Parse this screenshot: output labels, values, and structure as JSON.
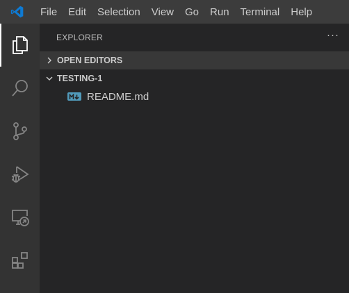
{
  "titlebar": {
    "app_icon": "vscode-logo-icon",
    "menu": [
      "File",
      "Edit",
      "Selection",
      "View",
      "Go",
      "Run",
      "Terminal",
      "Help"
    ]
  },
  "activitybar": {
    "items": [
      {
        "icon": "files-icon",
        "active": true
      },
      {
        "icon": "search-icon",
        "active": false
      },
      {
        "icon": "source-control-icon",
        "active": false
      },
      {
        "icon": "run-debug-icon",
        "active": false
      },
      {
        "icon": "remote-explorer-icon",
        "active": false
      },
      {
        "icon": "extensions-icon",
        "active": false
      }
    ]
  },
  "sidebar": {
    "title": "EXPLORER",
    "more_actions": "···",
    "sections": [
      {
        "label": "OPEN EDITORS",
        "expanded": false
      },
      {
        "label": "TESTING-1",
        "expanded": true
      }
    ],
    "files": [
      {
        "name": "README.md",
        "icon": "markdown-file-icon",
        "badge": "M↓"
      }
    ]
  },
  "colors": {
    "titlebar": "#3c3c3c",
    "activitybar": "#333333",
    "sidebar": "#252526",
    "accent": "#0e7ad3",
    "markdown_icon": "#519aba"
  }
}
